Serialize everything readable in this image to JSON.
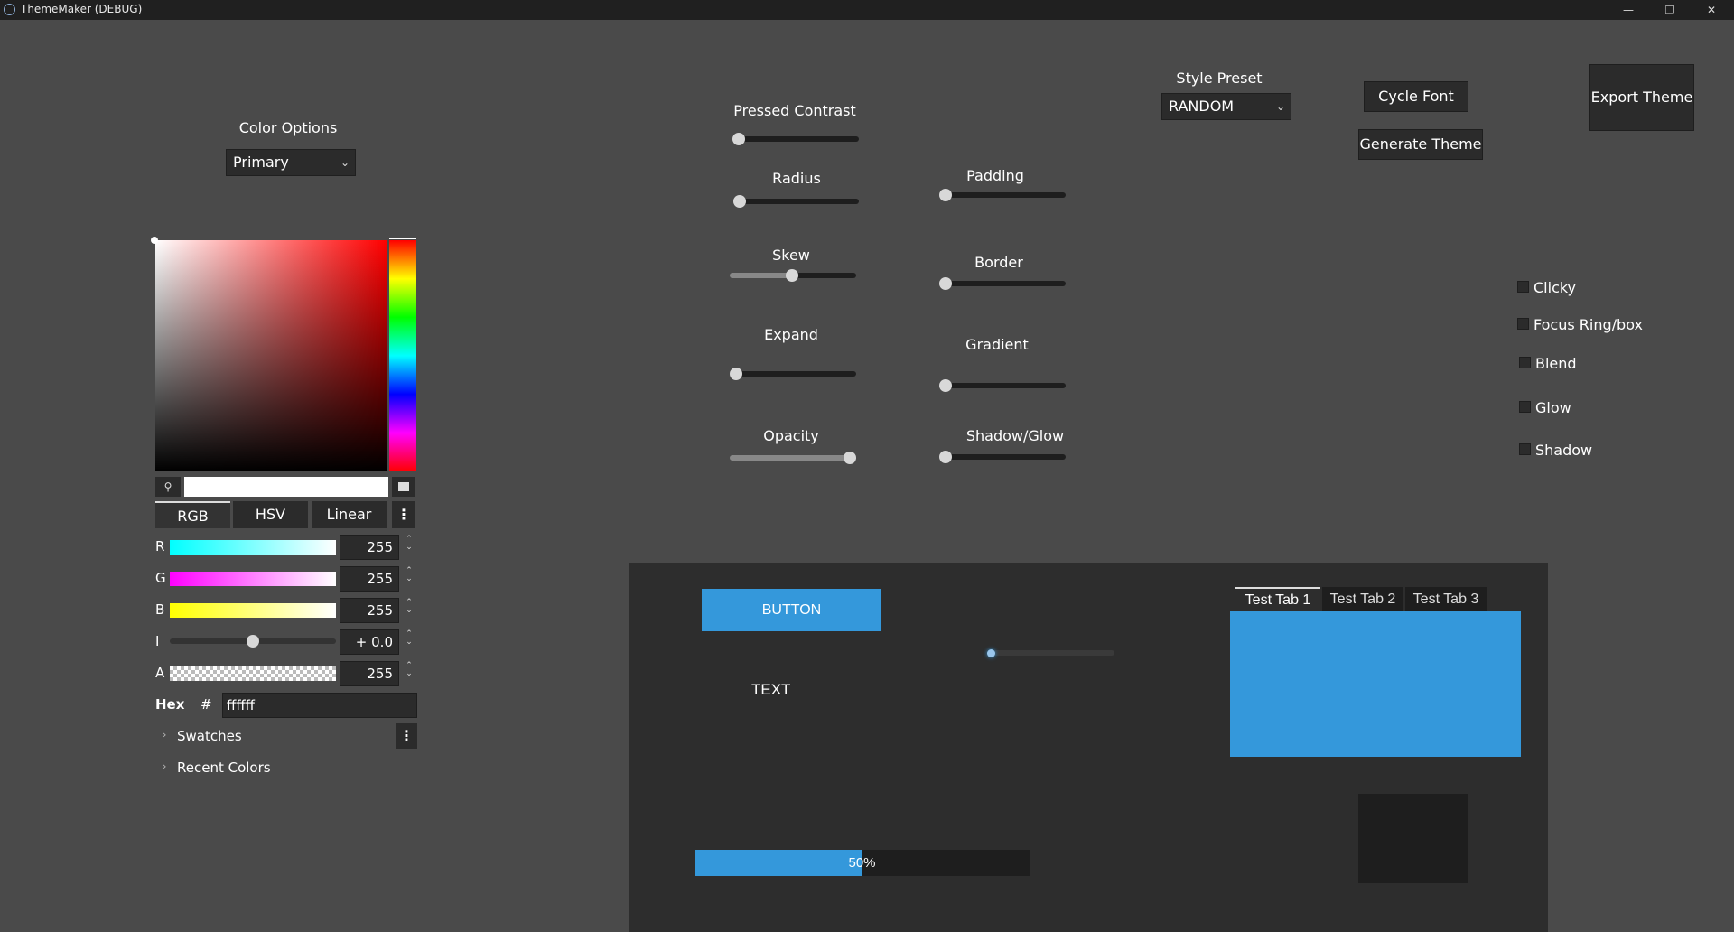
{
  "window": {
    "title": "ThemeMaker (DEBUG)",
    "minimize": "—",
    "restore": "❐",
    "close": "✕"
  },
  "color_options": {
    "label": "Color Options",
    "selected": "Primary"
  },
  "picker": {
    "modes": [
      "RGB",
      "HSV",
      "Linear"
    ],
    "channels": [
      {
        "name": "R",
        "value": "255"
      },
      {
        "name": "G",
        "value": "255"
      },
      {
        "name": "B",
        "value": "255"
      },
      {
        "name": "I",
        "value": "+ 0.0"
      },
      {
        "name": "A",
        "value": "255"
      }
    ],
    "hex_label": "Hex",
    "hash": "#",
    "hex_value": "ffffff",
    "swatches": "Swatches",
    "recent": "Recent Colors"
  },
  "sliders": {
    "pressed_contrast": "Pressed Contrast",
    "radius": "Radius",
    "skew": "Skew",
    "expand": "Expand",
    "opacity": "Opacity",
    "padding": "Padding",
    "border": "Border",
    "gradient": "Gradient",
    "shadow_glow": "Shadow/Glow"
  },
  "style_preset": {
    "label": "Style Preset",
    "selected": "RANDOM"
  },
  "buttons": {
    "cycle_font": "Cycle Font",
    "generate_theme": "Generate Theme",
    "export_theme": "Export Theme"
  },
  "checkboxes": [
    "Clicky",
    "Focus Ring/box",
    "Blend",
    "Glow",
    "Shadow"
  ],
  "preview": {
    "button": "BUTTON",
    "text": "TEXT",
    "progress": "50%",
    "progress_value": 0.5,
    "tabs": [
      "Test Tab 1",
      "Test Tab 2",
      "Test Tab 3"
    ],
    "accent": "#3498db"
  },
  "colors": {
    "background": "#4a4a4a",
    "accent": "#3498db",
    "panel": "#2d2d2d"
  }
}
